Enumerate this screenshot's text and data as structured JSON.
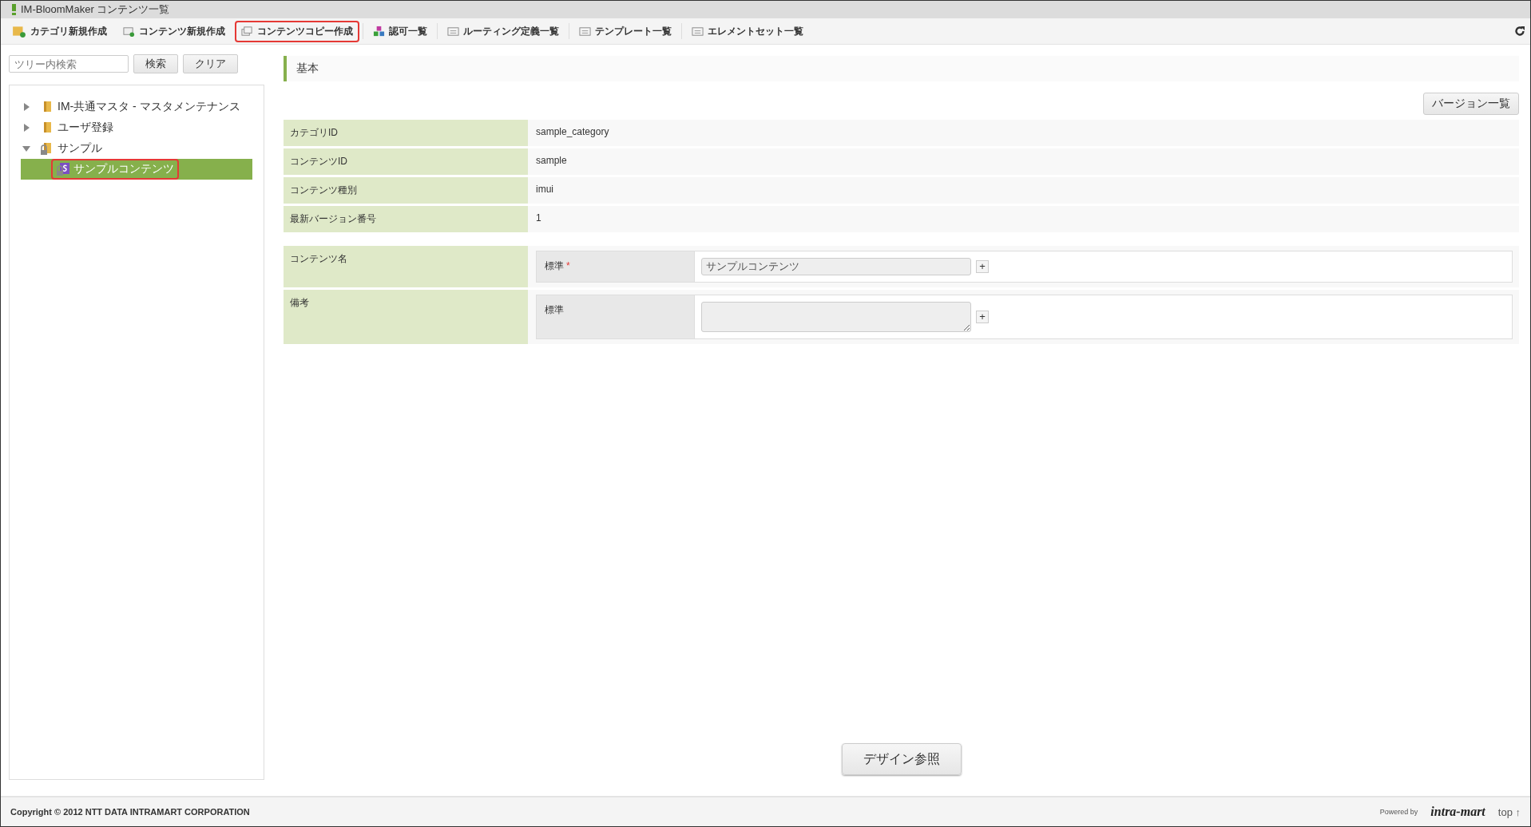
{
  "window": {
    "title": "IM-BloomMaker コンテンツ一覧"
  },
  "toolbar": [
    {
      "label": "カテゴリ新規作成",
      "kind": "category",
      "highlighted": false
    },
    {
      "label": "コンテンツ新規作成",
      "kind": "new",
      "highlighted": false
    },
    {
      "label": "コンテンツコピー作成",
      "kind": "copy",
      "highlighted": true
    },
    {
      "label": "認可一覧",
      "kind": "auth",
      "highlighted": false
    },
    {
      "label": "ルーティング定義一覧",
      "kind": "list",
      "highlighted": false
    },
    {
      "label": "テンプレート一覧",
      "kind": "list",
      "highlighted": false
    },
    {
      "label": "エレメントセット一覧",
      "kind": "list",
      "highlighted": false
    }
  ],
  "tree_search": {
    "placeholder": "ツリー内検索",
    "buttons": [
      "検索",
      "クリア"
    ]
  },
  "tree": [
    {
      "label": "IM-共通マスタ - マスタメンテナンス",
      "kind": "folder",
      "expanded": false,
      "locked": false,
      "selected": false,
      "highlighted": false
    },
    {
      "label": "ユーザ登録",
      "kind": "folder",
      "expanded": false,
      "locked": false,
      "selected": false,
      "highlighted": false
    },
    {
      "label": "サンプル",
      "kind": "folder",
      "expanded": true,
      "locked": true,
      "selected": false,
      "highlighted": false,
      "children": [
        {
          "label": "サンプルコンテンツ",
          "kind": "content",
          "locked": true,
          "selected": true,
          "highlighted": true
        }
      ]
    }
  ],
  "section": {
    "title": "基本",
    "version_button": "バージョン一覧"
  },
  "info_rows": [
    {
      "label": "カテゴリID",
      "value": "sample_category"
    },
    {
      "label": "コンテンツID",
      "value": "sample"
    },
    {
      "label": "コンテンツ種別",
      "value": "imui"
    },
    {
      "label": "最新バージョン番号",
      "value": "1"
    }
  ],
  "form_rows": [
    {
      "label": "コンテンツ名",
      "locale": "標準",
      "required": true,
      "kind": "input",
      "value": "サンプルコンテンツ",
      "add": "+"
    },
    {
      "label": "備考",
      "locale": "標準",
      "required": false,
      "kind": "textarea",
      "add": "+"
    }
  ],
  "required_mark": "*",
  "design_button": "デザイン参照",
  "footer": {
    "copyright": "Copyright © 2012 NTT DATA INTRAMART CORPORATION",
    "powered_by": "Powered by",
    "logo": "intra-mart",
    "top_link": "top ↑"
  }
}
